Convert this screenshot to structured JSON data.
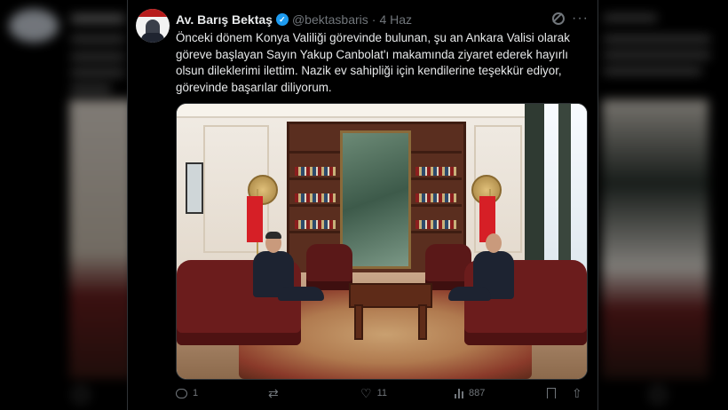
{
  "tweet": {
    "author_name": "Av. Barış Bektaş",
    "handle": "@bektasbaris",
    "separator": "·",
    "date": "4 Haz",
    "more_label": "···",
    "body_lines": [
      "Önceki dönem Konya Valiliği görevinde bulunan, şu an Ankara Valisi olarak",
      "göreve başlayan Sayın Yakup Canbolat'ı makamında ziyaret ederek hayırlı",
      "olsun dileklerimi ilettim. Nazik ev sahipliği için kendilerine teşekkür ediyor,",
      "görevinde başarılar diliyorum."
    ]
  },
  "actions": {
    "reply_count": "1",
    "retweet_count": "",
    "like_count": "11",
    "view_count": "887"
  },
  "icons": {
    "verified": "verified-badge-icon",
    "grok": "grok-icon",
    "more": "more-options-icon",
    "reply": "reply-icon",
    "retweet": "retweet-icon",
    "like": "heart-icon",
    "views": "views-bar-chart-icon",
    "bookmark": "bookmark-icon",
    "share": "share-icon"
  },
  "colors": {
    "background": "#000000",
    "primary_text": "#e7e9ea",
    "secondary_text": "#71767b",
    "verified_blue": "#1d9bf0",
    "border": "#2f3336"
  }
}
